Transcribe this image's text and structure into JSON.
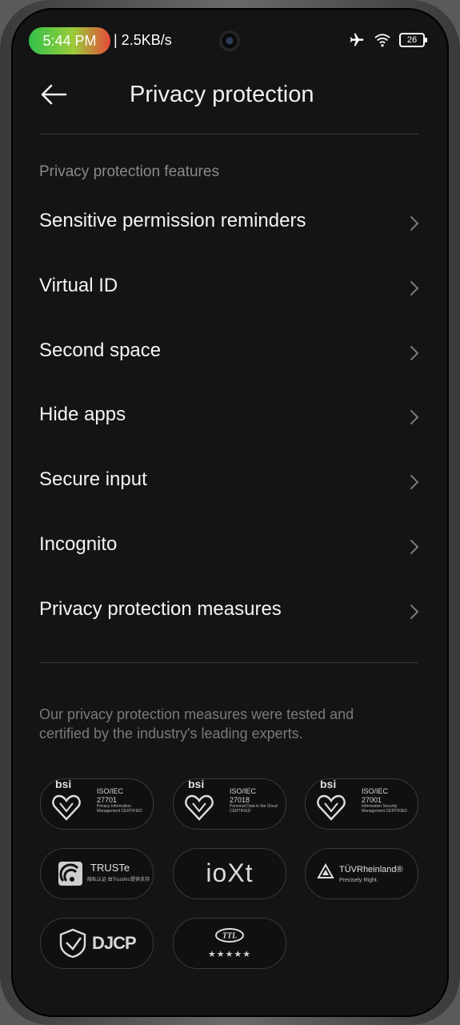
{
  "status_bar": {
    "time": "5:44 PM",
    "net_speed": "| 2.5KB/s",
    "battery": "26",
    "icons": [
      "airplane-icon",
      "wifi-icon",
      "battery-icon"
    ]
  },
  "header": {
    "title": "Privacy protection",
    "back_icon": "back-arrow-icon"
  },
  "section": {
    "label": "Privacy protection features",
    "items": [
      {
        "label": "Sensitive permission reminders"
      },
      {
        "label": "Virtual ID"
      },
      {
        "label": "Second space"
      },
      {
        "label": "Hide apps"
      },
      {
        "label": "Secure input"
      },
      {
        "label": "Incognito"
      },
      {
        "label": "Privacy protection measures"
      }
    ]
  },
  "note": "Our privacy protection measures were tested and certified by the industry's leading experts.",
  "certifications": [
    {
      "brand": "bsi",
      "title": "ISO/IEC",
      "number": "27701",
      "desc": "Privacy Information Management CERTIFIED"
    },
    {
      "brand": "bsi",
      "title": "ISO/IEC",
      "number": "27018",
      "desc": "Personal Data in the Cloud CERTIFIED"
    },
    {
      "brand": "bsi",
      "title": "ISO/IEC",
      "number": "27001",
      "desc": "Information Security Management CERTIFIED"
    },
    {
      "brand": "TRUSTe",
      "sub": "隐私认证 由TrustArc提供支持"
    },
    {
      "brand": "ioXt"
    },
    {
      "brand": "TÜVRheinland®",
      "sub": "Precisely Right."
    },
    {
      "brand": "DJCP"
    },
    {
      "brand": "TTL",
      "stars": "★★★★★"
    }
  ],
  "colors": {
    "background": "#141414",
    "text": "#f4f4f4",
    "secondary_text": "#8a8a8a",
    "time_pill_start": "#33c24a",
    "time_pill_end": "#e64a3a"
  }
}
